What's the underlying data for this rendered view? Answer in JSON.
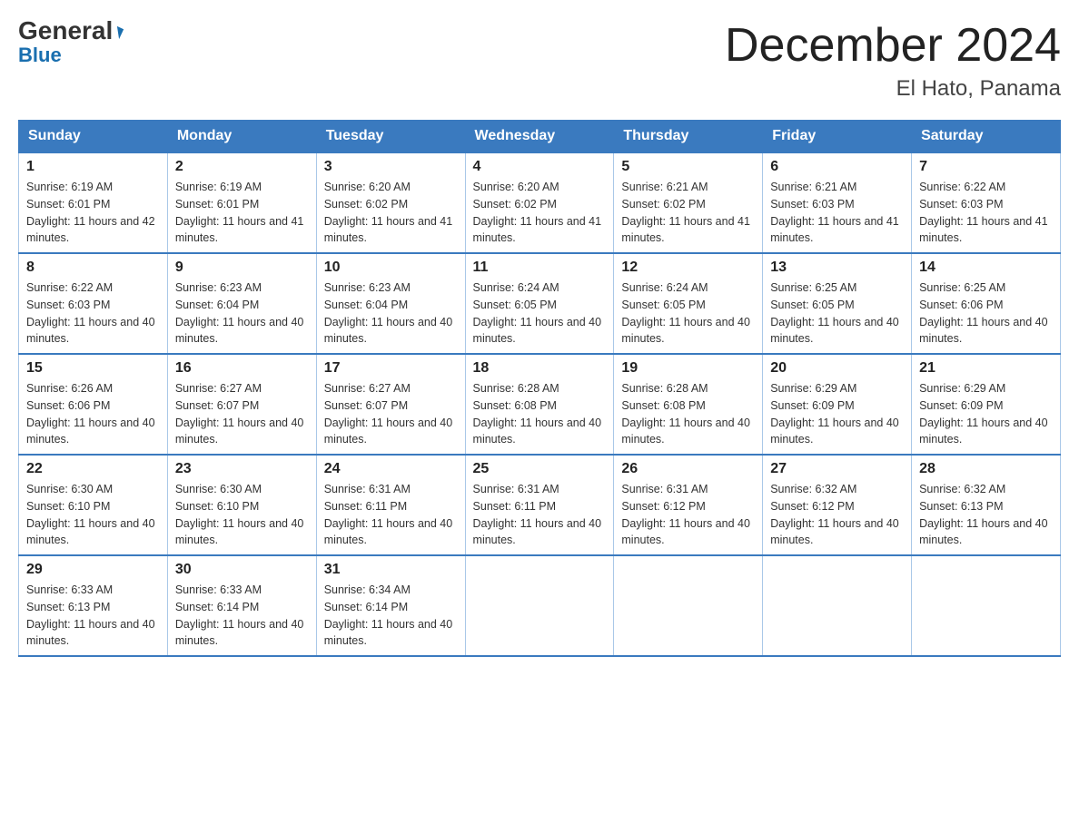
{
  "header": {
    "logo_general": "General",
    "logo_blue": "Blue",
    "month_title": "December 2024",
    "location": "El Hato, Panama"
  },
  "days_of_week": [
    "Sunday",
    "Monday",
    "Tuesday",
    "Wednesday",
    "Thursday",
    "Friday",
    "Saturday"
  ],
  "weeks": [
    [
      {
        "day": "1",
        "sunrise": "6:19 AM",
        "sunset": "6:01 PM",
        "daylight": "11 hours and 42 minutes."
      },
      {
        "day": "2",
        "sunrise": "6:19 AM",
        "sunset": "6:01 PM",
        "daylight": "11 hours and 41 minutes."
      },
      {
        "day": "3",
        "sunrise": "6:20 AM",
        "sunset": "6:02 PM",
        "daylight": "11 hours and 41 minutes."
      },
      {
        "day": "4",
        "sunrise": "6:20 AM",
        "sunset": "6:02 PM",
        "daylight": "11 hours and 41 minutes."
      },
      {
        "day": "5",
        "sunrise": "6:21 AM",
        "sunset": "6:02 PM",
        "daylight": "11 hours and 41 minutes."
      },
      {
        "day": "6",
        "sunrise": "6:21 AM",
        "sunset": "6:03 PM",
        "daylight": "11 hours and 41 minutes."
      },
      {
        "day": "7",
        "sunrise": "6:22 AM",
        "sunset": "6:03 PM",
        "daylight": "11 hours and 41 minutes."
      }
    ],
    [
      {
        "day": "8",
        "sunrise": "6:22 AM",
        "sunset": "6:03 PM",
        "daylight": "11 hours and 40 minutes."
      },
      {
        "day": "9",
        "sunrise": "6:23 AM",
        "sunset": "6:04 PM",
        "daylight": "11 hours and 40 minutes."
      },
      {
        "day": "10",
        "sunrise": "6:23 AM",
        "sunset": "6:04 PM",
        "daylight": "11 hours and 40 minutes."
      },
      {
        "day": "11",
        "sunrise": "6:24 AM",
        "sunset": "6:05 PM",
        "daylight": "11 hours and 40 minutes."
      },
      {
        "day": "12",
        "sunrise": "6:24 AM",
        "sunset": "6:05 PM",
        "daylight": "11 hours and 40 minutes."
      },
      {
        "day": "13",
        "sunrise": "6:25 AM",
        "sunset": "6:05 PM",
        "daylight": "11 hours and 40 minutes."
      },
      {
        "day": "14",
        "sunrise": "6:25 AM",
        "sunset": "6:06 PM",
        "daylight": "11 hours and 40 minutes."
      }
    ],
    [
      {
        "day": "15",
        "sunrise": "6:26 AM",
        "sunset": "6:06 PM",
        "daylight": "11 hours and 40 minutes."
      },
      {
        "day": "16",
        "sunrise": "6:27 AM",
        "sunset": "6:07 PM",
        "daylight": "11 hours and 40 minutes."
      },
      {
        "day": "17",
        "sunrise": "6:27 AM",
        "sunset": "6:07 PM",
        "daylight": "11 hours and 40 minutes."
      },
      {
        "day": "18",
        "sunrise": "6:28 AM",
        "sunset": "6:08 PM",
        "daylight": "11 hours and 40 minutes."
      },
      {
        "day": "19",
        "sunrise": "6:28 AM",
        "sunset": "6:08 PM",
        "daylight": "11 hours and 40 minutes."
      },
      {
        "day": "20",
        "sunrise": "6:29 AM",
        "sunset": "6:09 PM",
        "daylight": "11 hours and 40 minutes."
      },
      {
        "day": "21",
        "sunrise": "6:29 AM",
        "sunset": "6:09 PM",
        "daylight": "11 hours and 40 minutes."
      }
    ],
    [
      {
        "day": "22",
        "sunrise": "6:30 AM",
        "sunset": "6:10 PM",
        "daylight": "11 hours and 40 minutes."
      },
      {
        "day": "23",
        "sunrise": "6:30 AM",
        "sunset": "6:10 PM",
        "daylight": "11 hours and 40 minutes."
      },
      {
        "day": "24",
        "sunrise": "6:31 AM",
        "sunset": "6:11 PM",
        "daylight": "11 hours and 40 minutes."
      },
      {
        "day": "25",
        "sunrise": "6:31 AM",
        "sunset": "6:11 PM",
        "daylight": "11 hours and 40 minutes."
      },
      {
        "day": "26",
        "sunrise": "6:31 AM",
        "sunset": "6:12 PM",
        "daylight": "11 hours and 40 minutes."
      },
      {
        "day": "27",
        "sunrise": "6:32 AM",
        "sunset": "6:12 PM",
        "daylight": "11 hours and 40 minutes."
      },
      {
        "day": "28",
        "sunrise": "6:32 AM",
        "sunset": "6:13 PM",
        "daylight": "11 hours and 40 minutes."
      }
    ],
    [
      {
        "day": "29",
        "sunrise": "6:33 AM",
        "sunset": "6:13 PM",
        "daylight": "11 hours and 40 minutes."
      },
      {
        "day": "30",
        "sunrise": "6:33 AM",
        "sunset": "6:14 PM",
        "daylight": "11 hours and 40 minutes."
      },
      {
        "day": "31",
        "sunrise": "6:34 AM",
        "sunset": "6:14 PM",
        "daylight": "11 hours and 40 minutes."
      },
      null,
      null,
      null,
      null
    ]
  ]
}
